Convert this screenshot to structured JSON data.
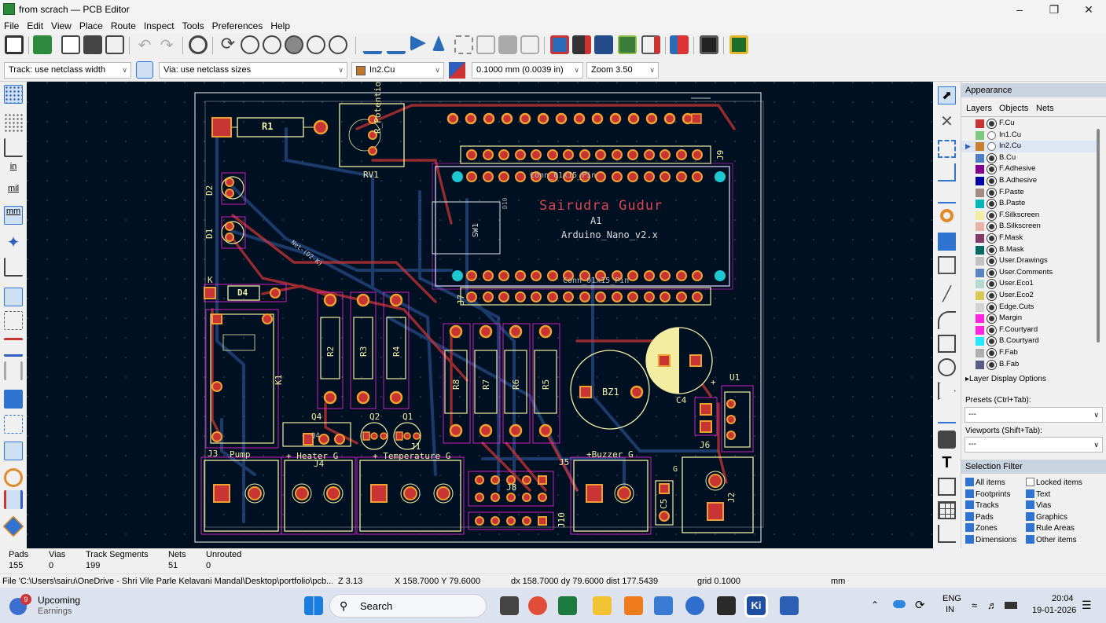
{
  "window": {
    "title": "from scrach — PCB Editor",
    "min_icon": "minimize-icon",
    "max_icon": "restore-icon",
    "close_icon": "close-icon"
  },
  "menu": [
    "File",
    "Edit",
    "View",
    "Place",
    "Route",
    "Inspect",
    "Tools",
    "Preferences",
    "Help"
  ],
  "toolbar2": {
    "track": "Track: use netclass width",
    "via": "Via: use netclass sizes",
    "layer": "In2.Cu",
    "layer_color": "#c07830",
    "grid": "0.1000 mm (0.0039 in)",
    "zoom": "Zoom 3.50"
  },
  "left_toolbar": {
    "in_label": "in",
    "mil_label": "mil",
    "mm_label": "mm"
  },
  "board": {
    "designer_text": "Sairudra Gudur",
    "module_ref": "A1",
    "module_value": "Arduino_Nano_v2.x",
    "refs": [
      "R1",
      "RV1",
      "R_Potentiometer",
      "J9",
      "D2",
      "D1",
      "D4",
      "K",
      "K1",
      "R2",
      "R3",
      "R4",
      "R8",
      "R7",
      "R6",
      "R5",
      "BZ1",
      "C4",
      "U1",
      "J6",
      "Q4",
      "Q2",
      "Q1",
      "J1",
      "J3",
      "J4",
      "J5",
      "J8",
      "J10",
      "C5",
      "J2",
      "J7",
      "D10",
      "SW1"
    ],
    "connector_labels": [
      "Pump",
      "+ Heater  G",
      "+ Temperature  G",
      "+Buzzer  G"
    ],
    "netlabel": "Net-(D2-K)",
    "silk_misc": [
      "Conn_01x15_Pin",
      "Conn_01x15_Pin",
      "Q4",
      "+",
      "G"
    ]
  },
  "appearance": {
    "header": "Appearance",
    "tabs": [
      "Layers",
      "Objects",
      "Nets"
    ],
    "layers": [
      {
        "name": "F.Cu",
        "color": "#c83434"
      },
      {
        "name": "In1.Cu",
        "color": "#7fc87f"
      },
      {
        "name": "In2.Cu",
        "color": "#c88030"
      },
      {
        "name": "B.Cu",
        "color": "#4d7fc4"
      },
      {
        "name": "F.Adhesive",
        "color": "#84008c"
      },
      {
        "name": "B.Adhesive",
        "color": "#0000a8"
      },
      {
        "name": "F.Paste",
        "color": "#a38c82"
      },
      {
        "name": "B.Paste",
        "color": "#00b7b7"
      },
      {
        "name": "F.Silkscreen",
        "color": "#f2eda1"
      },
      {
        "name": "B.Silkscreen",
        "color": "#e8b2a7"
      },
      {
        "name": "F.Mask",
        "color": "#843a68"
      },
      {
        "name": "B.Mask",
        "color": "#026a62"
      },
      {
        "name": "User.Drawings",
        "color": "#c2c2c2"
      },
      {
        "name": "User.Comments",
        "color": "#5984c4"
      },
      {
        "name": "User.Eco1",
        "color": "#b4dbd2"
      },
      {
        "name": "User.Eco2",
        "color": "#d8c852"
      },
      {
        "name": "Edge.Cuts",
        "color": "#d0d2cd"
      },
      {
        "name": "Margin",
        "color": "#ff26e2"
      },
      {
        "name": "F.Courtyard",
        "color": "#ff26e2"
      },
      {
        "name": "B.Courtyard",
        "color": "#26e9ff"
      },
      {
        "name": "F.Fab",
        "color": "#afafaf"
      },
      {
        "name": "B.Fab",
        "color": "#585d84"
      }
    ],
    "layer_display_options": "Layer Display Options",
    "presets_label": "Presets (Ctrl+Tab):",
    "presets_value": "---",
    "viewports_label": "Viewports (Shift+Tab):",
    "viewports_value": "---"
  },
  "selection_filter": {
    "header": "Selection Filter",
    "items": [
      {
        "label": "All items",
        "checked": true
      },
      {
        "label": "Locked items",
        "checked": false
      },
      {
        "label": "Footprints",
        "checked": true
      },
      {
        "label": "Text",
        "checked": true
      },
      {
        "label": "Tracks",
        "checked": true
      },
      {
        "label": "Vias",
        "checked": true
      },
      {
        "label": "Pads",
        "checked": true
      },
      {
        "label": "Graphics",
        "checked": true
      },
      {
        "label": "Zones",
        "checked": true
      },
      {
        "label": "Rule Areas",
        "checked": true
      },
      {
        "label": "Dimensions",
        "checked": true
      },
      {
        "label": "Other items",
        "checked": true
      }
    ]
  },
  "stats": {
    "pads_label": "Pads",
    "pads": "155",
    "vias_label": "Vias",
    "vias": "0",
    "tracks_label": "Track Segments",
    "tracks": "199",
    "nets_label": "Nets",
    "nets": "51",
    "unrouted_label": "Unrouted",
    "unrouted": "0"
  },
  "status": {
    "file": "File 'C:\\Users\\sairu\\OneDrive - Shri Vile Parle Kelavani Mandal\\Desktop\\portfolio\\pcb...",
    "zoom": "Z 3.13",
    "xy": "X 158.7000  Y 79.6000",
    "dxy": "dx 158.7000  dy 79.6000  dist 177.5439",
    "grid": "grid 0.1000",
    "units": "mm"
  },
  "taskbar": {
    "badge": "9",
    "news_title": "Upcoming",
    "news_sub": "Earnings",
    "search": "Search",
    "lang1": "ENG",
    "lang2": "IN",
    "time": "20:04",
    "date": "19-01-2026"
  }
}
